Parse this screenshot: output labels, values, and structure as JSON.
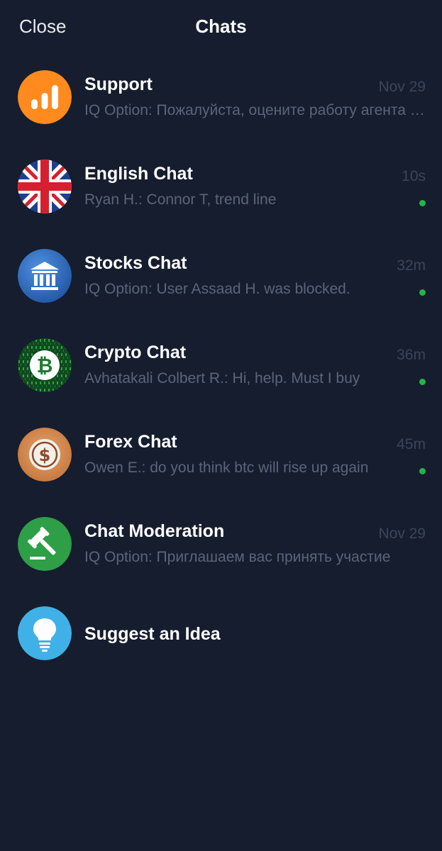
{
  "header": {
    "close_label": "Close",
    "title": "Chats"
  },
  "chats": [
    {
      "name": "Support",
      "time": "Nov 29",
      "preview": "IQ Option: Пожалуйста, оцените работу агента поддержки",
      "online": false,
      "icon": "bar-chart-icon",
      "color": "#ff8a1e"
    },
    {
      "name": "English Chat",
      "time": "10s",
      "preview": "Ryan H.: Connor T, trend line",
      "online": true,
      "icon": "uk-flag-icon",
      "color": "#1f3f8f"
    },
    {
      "name": "Stocks Chat",
      "time": "32m",
      "preview": "IQ Option: User Assaad H. was blocked.",
      "online": true,
      "icon": "bank-building-icon",
      "color": "#2e6fc6"
    },
    {
      "name": "Crypto Chat",
      "time": "36m",
      "preview": "Avhatakali Colbert R.: Hi, help. Must I buy",
      "online": true,
      "icon": "bitcoin-icon",
      "color": "#1f7a32"
    },
    {
      "name": "Forex Chat",
      "time": "45m",
      "preview": "Owen E.: do you think btc will rise up again",
      "online": true,
      "icon": "dollar-coin-icon",
      "color": "#d58a4c"
    },
    {
      "name": "Chat Moderation",
      "time": "Nov 29",
      "preview": "IQ Option: Приглашаем вас принять участие",
      "online": false,
      "icon": "gavel-icon",
      "color": "#2e9e47"
    }
  ],
  "suggest": {
    "name": "Suggest an Idea",
    "icon": "lightbulb-icon",
    "color": "#3fb1e6"
  },
  "colors": {
    "background": "#161d2e",
    "online_dot": "#27b24a",
    "time_text": "#3b4559",
    "preview_text": "#5b6579"
  }
}
